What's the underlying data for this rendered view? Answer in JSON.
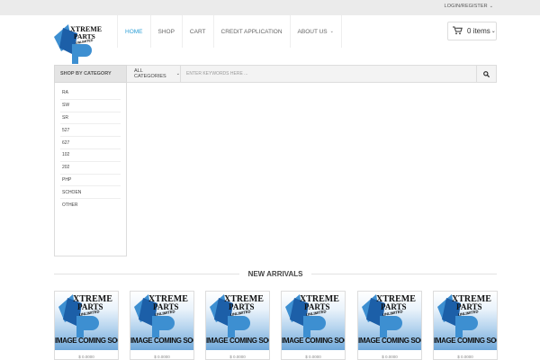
{
  "topbar": {
    "login_label": "LOGIN/REGISTER"
  },
  "logo": {
    "line1": "XTREME",
    "line2": "PARTS",
    "line3": "UNLIMITED"
  },
  "nav": {
    "items": [
      {
        "label": "HOME",
        "active": true
      },
      {
        "label": "SHOP"
      },
      {
        "label": "CART"
      },
      {
        "label": "CREDIT APPLICATION"
      },
      {
        "label": "ABOUT US"
      }
    ]
  },
  "cart": {
    "count_label": "0 items"
  },
  "sidebar": {
    "title": "SHOP BY CATEGORY",
    "categories": [
      "RA",
      "SW",
      "SR",
      "527",
      "627",
      "102",
      "202",
      "PHP",
      "SCHOEN",
      "OTHER"
    ]
  },
  "search": {
    "category_label": "ALL CATEGORIES",
    "placeholder": "ENTER KEYWORDS HERE ..."
  },
  "arrivals": {
    "title": "NEW ARRIVALS",
    "products": [
      {
        "image_text": "IMAGE COMING SOON",
        "price": "$ 0.0000"
      },
      {
        "image_text": "IMAGE COMING SOON",
        "price": "$ 0.0000"
      },
      {
        "image_text": "IMAGE COMING SOON",
        "price": "$ 0.0000"
      },
      {
        "image_text": "IMAGE COMING SOON",
        "price": "$ 0.0000"
      },
      {
        "image_text": "IMAGE COMING SOON",
        "price": "$ 0.0000"
      },
      {
        "image_text": "IMAGE COMING SOON",
        "price": "$ 0.0000"
      }
    ]
  },
  "colors": {
    "accent": "#2e9fd6",
    "logo_blue": "#3d8fd1"
  }
}
